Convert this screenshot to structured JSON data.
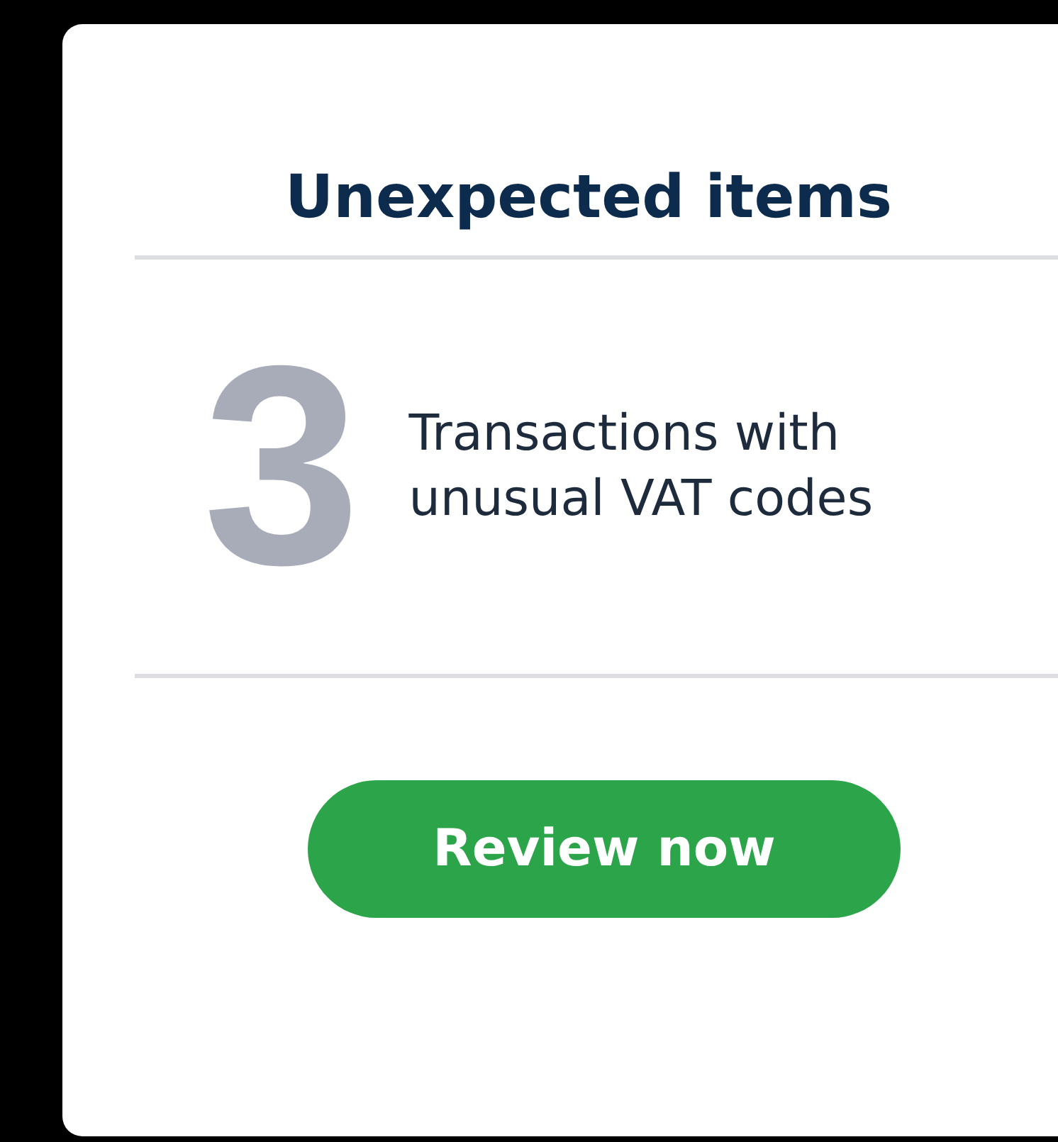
{
  "card": {
    "title": "Unexpected items",
    "count": "3",
    "description": "Transactions with unusual VAT codes",
    "button": "Review now"
  }
}
